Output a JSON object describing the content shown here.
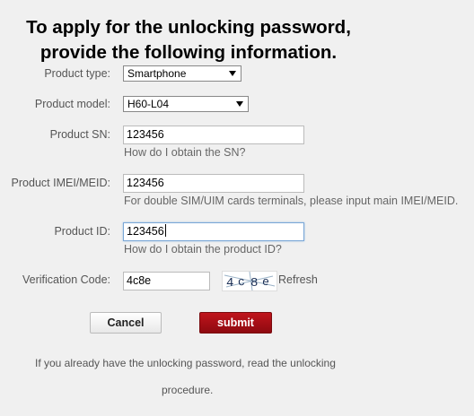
{
  "heading": {
    "line1": "To apply for the unlocking password,",
    "line2": "provide the following information."
  },
  "form": {
    "product_type": {
      "label": "Product type:",
      "value": "Smartphone"
    },
    "product_model": {
      "label": "Product model:",
      "value": "H60-L04"
    },
    "product_sn": {
      "label": "Product SN:",
      "value": "123456",
      "hint": "How do I obtain the SN?"
    },
    "product_imei": {
      "label": "Product IMEI/MEID:",
      "value": "123456",
      "hint": "For double SIM/UIM cards terminals, please input main IMEI/MEID."
    },
    "product_id": {
      "label": "Product ID:",
      "value": "123456",
      "hint": "How do I obtain the product ID?"
    },
    "verification": {
      "label": "Verification Code:",
      "value": "4c8e",
      "captcha_text": "4c8e",
      "refresh": "Refresh"
    }
  },
  "buttons": {
    "cancel": "Cancel",
    "submit": "submit"
  },
  "footer": {
    "line1": "If you already have the unlocking password, read the unlocking",
    "line2": "procedure."
  }
}
